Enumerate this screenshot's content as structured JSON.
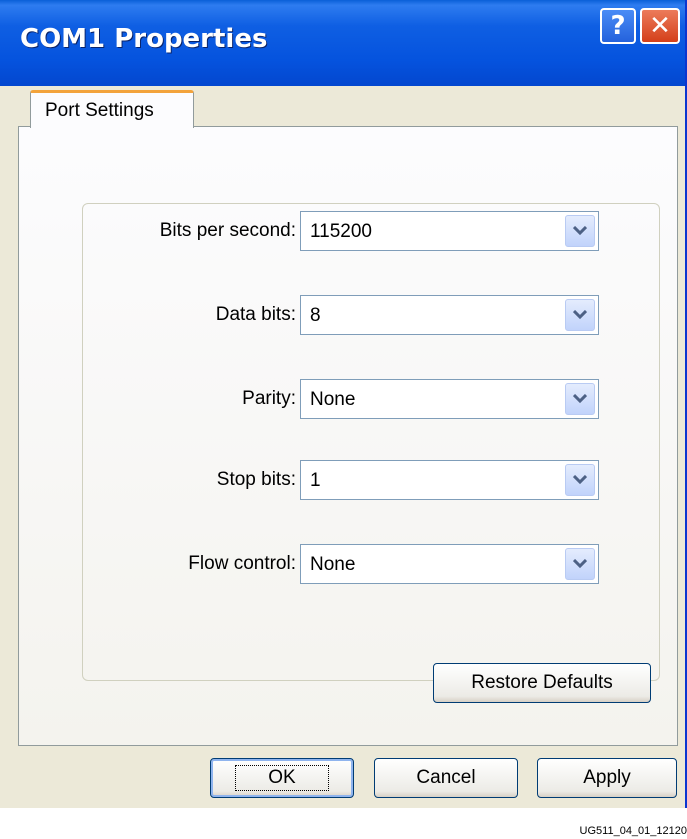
{
  "window": {
    "title": "COM1 Properties",
    "help_glyph": "?",
    "close_glyph": "✕"
  },
  "tabs": [
    {
      "label": "Port Settings",
      "active": true
    }
  ],
  "fields": {
    "bits_per_second": {
      "label": "Bits per second:",
      "value": "115200"
    },
    "data_bits": {
      "label": "Data bits:",
      "value": "8"
    },
    "parity": {
      "label": "Parity:",
      "value": "None"
    },
    "stop_bits": {
      "label": "Stop bits:",
      "value": "1"
    },
    "flow_control": {
      "label": "Flow control:",
      "value": "None"
    }
  },
  "buttons": {
    "restore_defaults": "Restore Defaults",
    "ok": "OK",
    "cancel": "Cancel",
    "apply": "Apply"
  },
  "footer": {
    "figure_id": "UG511_04_01_12120"
  },
  "colors": {
    "titlebar_blue": "#0553de",
    "window_bg": "#ece9d8",
    "tab_accent": "#f3a33b",
    "close_red": "#d4401a"
  }
}
